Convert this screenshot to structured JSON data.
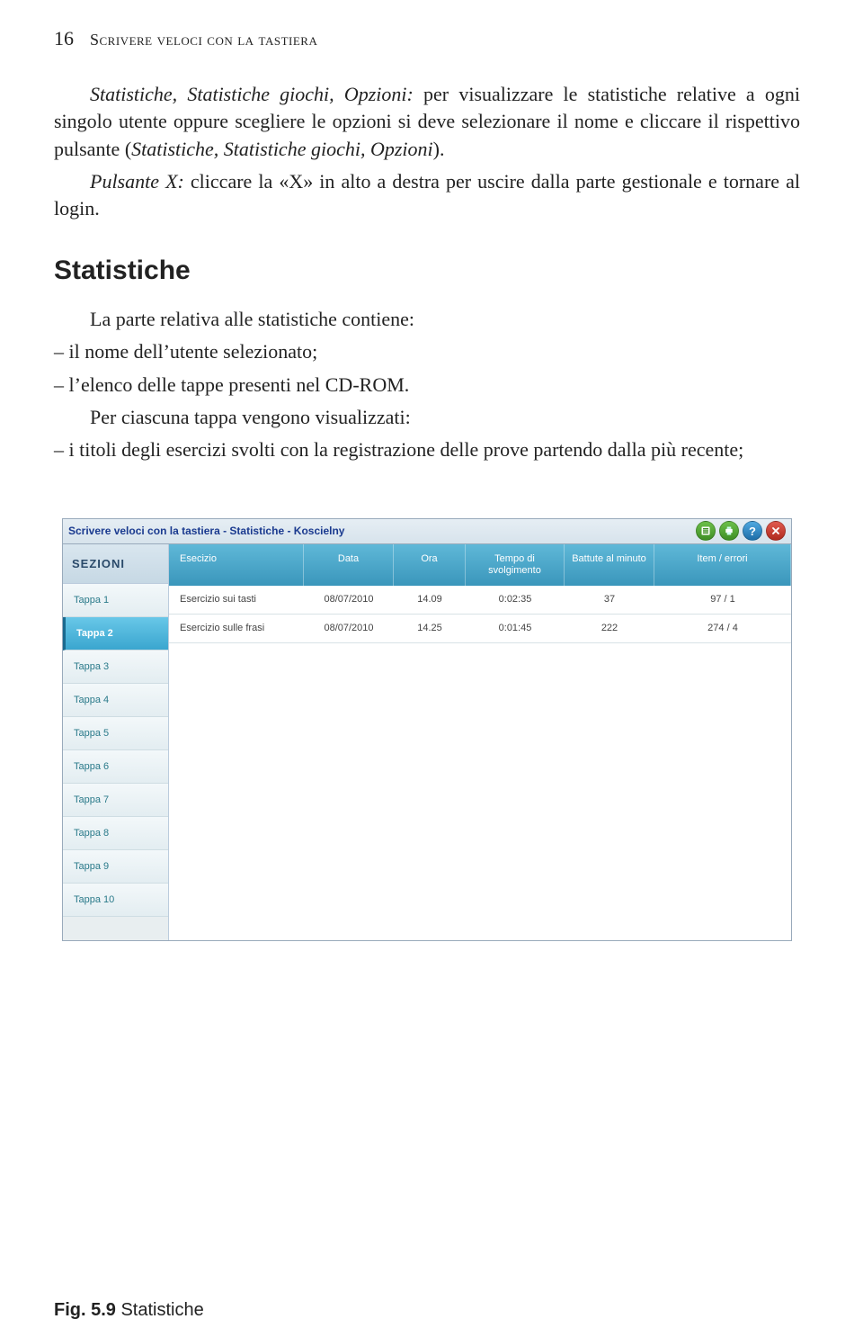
{
  "page_number": "16",
  "running_head": "Scrivere veloci con la tastiera",
  "para1_a": "Statistiche, Statistiche giochi, Opzioni:",
  "para1_b": " per visualizzare le statistiche relative a ogni singolo utente oppure scegliere le opzioni si deve selezionare il nome e cliccare il rispettivo pulsante (",
  "para1_c": "Statistiche, Statistiche giochi, Opzioni",
  "para1_d": ").",
  "para2_a": "Pulsante X:",
  "para2_b": " cliccare la «X» in alto a destra per uscire dalla parte gestionale e tornare al login.",
  "section_title": "Statistiche",
  "para3": "La parte relativa alle statistiche contiene:",
  "li1": "– il nome dell’utente selezionato;",
  "li2": "– l’elenco delle tappe presenti nel CD-ROM.",
  "para4": "Per ciascuna tappa vengono visualizzati:",
  "li3": "– i titoli degli esercizi svolti con la registrazione delle prove partendo dalla più recente;",
  "fig_label": "Fig. 5.9",
  "fig_caption": " Statistiche",
  "app": {
    "title": "Scrivere veloci con la tastiera - Statistiche - Koscielny",
    "sidebar_head": "SEZIONI",
    "sidebar_items": [
      "Tappa 1",
      "Tappa 2",
      "Tappa 3",
      "Tappa 4",
      "Tappa 5",
      "Tappa 6",
      "Tappa 7",
      "Tappa 8",
      "Tappa 9",
      "Tappa 10"
    ],
    "active_index": 1,
    "columns": {
      "esercizio": "Esecizio",
      "data": "Data",
      "ora": "Ora",
      "tempo": "Tempo di svolgimento",
      "battute": "Battute al minuto",
      "item": "Item / errori"
    },
    "rows": [
      {
        "ex": "Esercizio sui tasti",
        "data": "08/07/2010",
        "ora": "14.09",
        "tempo": "0:02:35",
        "batt": "37",
        "item": "97 / 1"
      },
      {
        "ex": "Esercizio sulle frasi",
        "data": "08/07/2010",
        "ora": "14.25",
        "tempo": "0:01:45",
        "batt": "222",
        "item": "274 / 4"
      }
    ]
  }
}
